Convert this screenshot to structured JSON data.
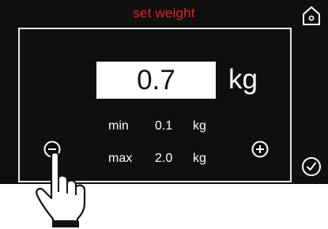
{
  "screen": {
    "title": "set weight",
    "colors": {
      "background": "#0f0f0f",
      "title": "#e0262c",
      "text": "#ffffff",
      "value_box": "#ffffff"
    }
  },
  "value": {
    "current": "0.7",
    "unit": "kg"
  },
  "limits": {
    "min": {
      "label": "min",
      "value": "0.1",
      "unit": "kg"
    },
    "max": {
      "label": "max",
      "value": "2.0",
      "unit": "kg"
    }
  },
  "icons": {
    "home": "home-icon",
    "confirm": "check-circle-icon",
    "decrease": "minus-circle-icon",
    "increase": "plus-circle-icon",
    "pointer": "pointing-hand-icon"
  }
}
